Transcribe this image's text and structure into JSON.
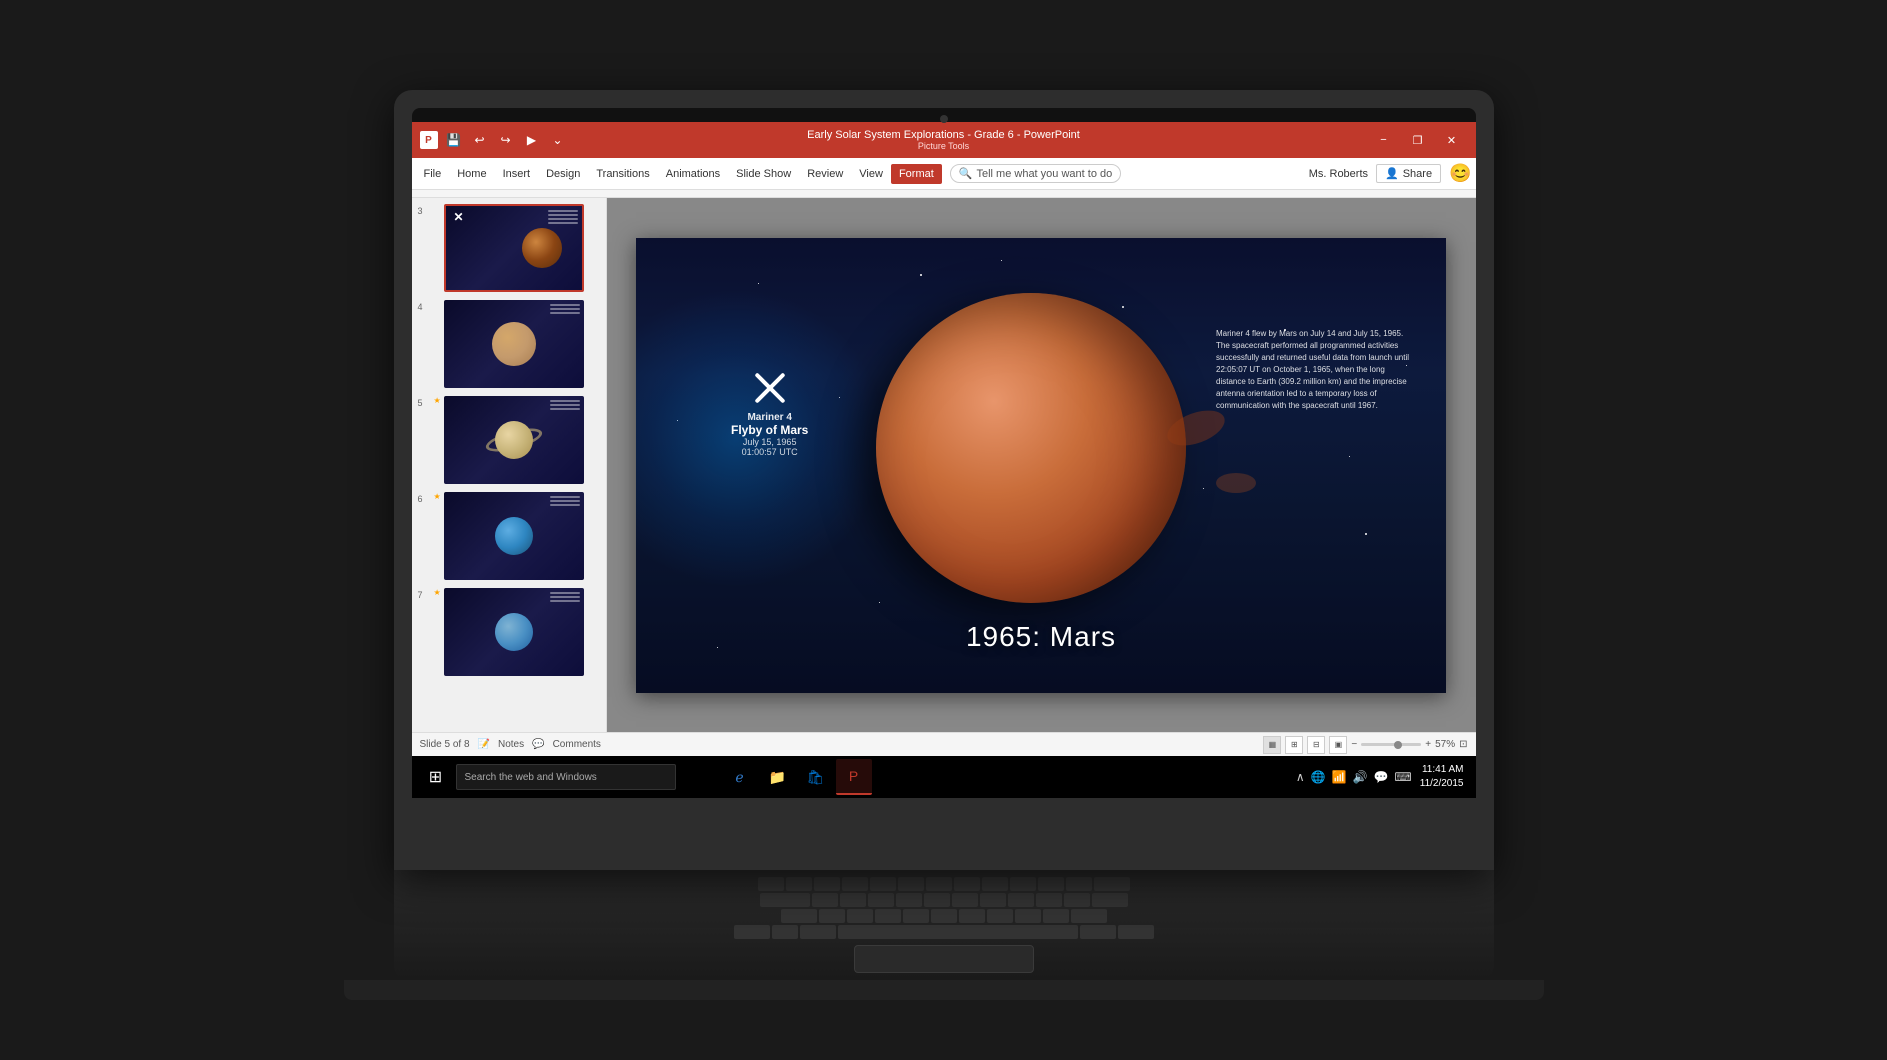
{
  "titleBar": {
    "title": "Early Solar System Explorations - Grade 6 - PowerPoint",
    "pictureTools": "Picture Tools",
    "minimizeLabel": "−",
    "restoreLabel": "❐",
    "closeLabel": "✕"
  },
  "menuBar": {
    "items": [
      {
        "label": "File",
        "active": false
      },
      {
        "label": "Home",
        "active": false
      },
      {
        "label": "Insert",
        "active": false
      },
      {
        "label": "Design",
        "active": false
      },
      {
        "label": "Transitions",
        "active": false
      },
      {
        "label": "Animations",
        "active": false
      },
      {
        "label": "Slide Show",
        "active": false
      },
      {
        "label": "Review",
        "active": false
      },
      {
        "label": "View",
        "active": false
      },
      {
        "label": "Format",
        "active": true
      }
    ],
    "tellMe": "Tell me what you want to do",
    "userName": "Ms. Roberts",
    "shareLabel": "Share"
  },
  "slides": [
    {
      "number": "3",
      "hasStar": false,
      "planet": "mars"
    },
    {
      "number": "4",
      "hasStar": false,
      "planet": "jupiter"
    },
    {
      "number": "5",
      "hasStar": true,
      "planet": "saturn"
    },
    {
      "number": "6",
      "hasStar": true,
      "planet": "uranus"
    },
    {
      "number": "7",
      "hasStar": true,
      "planet": "neptune"
    }
  ],
  "slideContent": {
    "title": "1965: Mars",
    "marinerName": "Mariner 4",
    "marinerTitle": "Flyby of Mars",
    "marinerDate": "July 15, 1965",
    "marinerTime": "01:00:57 UTC",
    "description": "Mariner 4 flew by Mars on July 14 and July 15, 1965. The spacecraft performed all programmed activities successfully and returned useful data from launch until 22:05:07 UT on October 1, 1965, when the long distance to Earth (309.2 million km) and the imprecise antenna orientation led to a temporary loss of communication with the spacecraft until 1967."
  },
  "statusBar": {
    "slideInfo": "Slide 5 of 8",
    "notesLabel": "Notes",
    "commentsLabel": "Comments",
    "zoomPercent": "57%",
    "plusLabel": "+",
    "minusLabel": "−"
  },
  "taskbar": {
    "searchPlaceholder": "Search the web and Windows",
    "clock": "11:41 AM",
    "date": "11/2/2015"
  }
}
